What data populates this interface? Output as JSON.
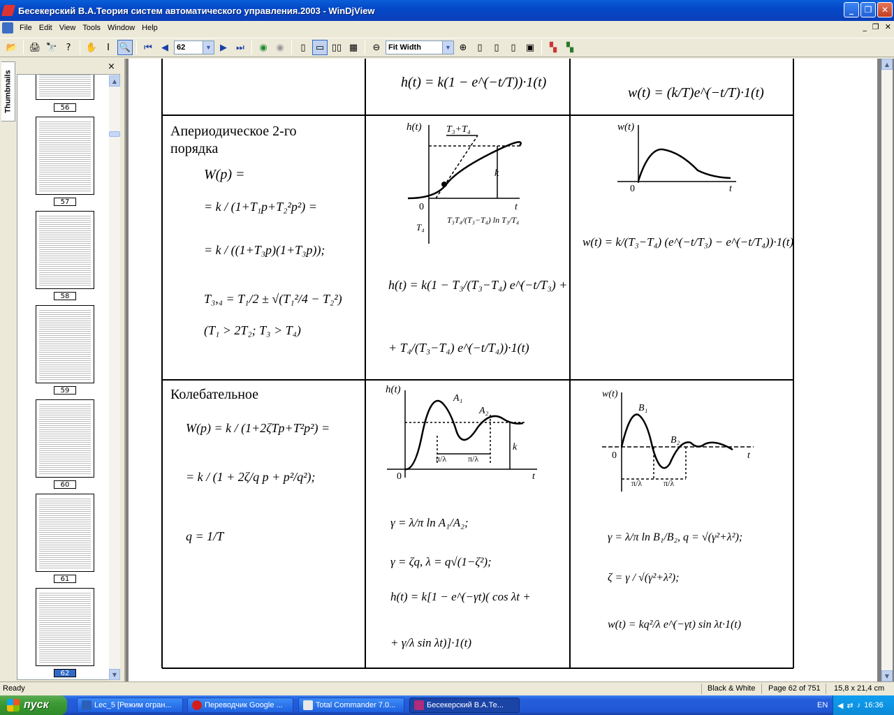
{
  "window": {
    "title": "Бесекерский В.А.Теория систем автоматического управления.2003 - WinDjView"
  },
  "menu": {
    "items": [
      "File",
      "Edit",
      "View",
      "Tools",
      "Window",
      "Help"
    ]
  },
  "toolbar": {
    "page_number": "62",
    "zoom": "Fit Width"
  },
  "sidebar": {
    "tab_label": "Thumbnails",
    "close": "×",
    "thumbnails": [
      {
        "page": "56",
        "selected": false
      },
      {
        "page": "57",
        "selected": false
      },
      {
        "page": "58",
        "selected": false
      },
      {
        "page": "59",
        "selected": false
      },
      {
        "page": "60",
        "selected": false
      },
      {
        "page": "61",
        "selected": false
      },
      {
        "page": "62",
        "selected": true
      }
    ]
  },
  "document": {
    "rows": [
      {
        "name": "",
        "col2_formula": "h(t) = k(1 − e^(−t/T))·1(t)",
        "col3_formula": "w(t) = (k/T)e^(−t/T)·1(t)"
      },
      {
        "name": "Апериодическое 2-го порядка",
        "formulas": [
          "W(p) =",
          "= k / (1+T₁p+T₂²p²) =",
          "= k / ((1+T₃p)(1+T₃p));",
          "T₃,₄ = T₁/2 ± √(T₁²/4 − T₂²)",
          "(T₁ > 2T₂; T₃ > T₄)"
        ],
        "graph_h_labels": [
          "h(t)",
          "T₃+T₄",
          "k",
          "0",
          "t",
          "T₄",
          "T₃T₄/(T₃−T₄) ln T₃/T₄"
        ],
        "h_formula": [
          "h(t) = k(1 − T₃/(T₃−T₄) e^(−t/T₃) +",
          "+ T₄/(T₃−T₄) e^(−t/T₄))·1(t)"
        ],
        "graph_w_labels": [
          "w(t)",
          "0",
          "t"
        ],
        "w_formula": "w(t) = k/(T₃−T₄) (e^(−t/T₃) − e^(−t/T₄))·1(t)"
      },
      {
        "name": "Колебательное",
        "formulas": [
          "W(p) = k / (1+2ζTp+T²p²) =",
          "= k / (1 + 2ζ/q p + p²/q²);",
          "q = 1/T"
        ],
        "graph_h_labels": [
          "h(t)",
          "A₁",
          "A₂",
          "π/λ",
          "π/λ",
          "k",
          "0",
          "t"
        ],
        "h_formulas": [
          "γ = λ/π ln A₁/A₂;",
          "γ = ζq, λ = q√(1−ζ²);",
          "h(t) = k[1 − e^(−γt)( cos λt +",
          "+ γ/λ sin λt)]·1(t)"
        ],
        "graph_w_labels": [
          "w(t)",
          "B₁",
          "B₂",
          "0",
          "t",
          "π/λ",
          "π/λ"
        ],
        "w_formulas": [
          "γ = λ/π ln B₁/B₂, q = √(γ²+λ²);",
          "ζ = γ / √(γ²+λ²);",
          "w(t) = kq²/λ e^(−γt) sin λt·1(t)"
        ]
      }
    ]
  },
  "status": {
    "ready": "Ready",
    "mode": "Black & White",
    "page": "Page 62 of 751",
    "size": "15,8 x 21,4 cm"
  },
  "taskbar": {
    "start": "пуск",
    "tasks": [
      {
        "label": "Lec_5 [Режим огран...",
        "color": "#2b5fb8",
        "active": false
      },
      {
        "label": "Переводчик Google ...",
        "color": "#d21d1d",
        "active": false
      },
      {
        "label": "Total Commander 7.0...",
        "color": "#e8e8e8",
        "active": false
      },
      {
        "label": "Бесекерский В.А.Те...",
        "color": "#b02b7a",
        "active": true
      }
    ],
    "lang": "EN",
    "clock": "16:36"
  }
}
